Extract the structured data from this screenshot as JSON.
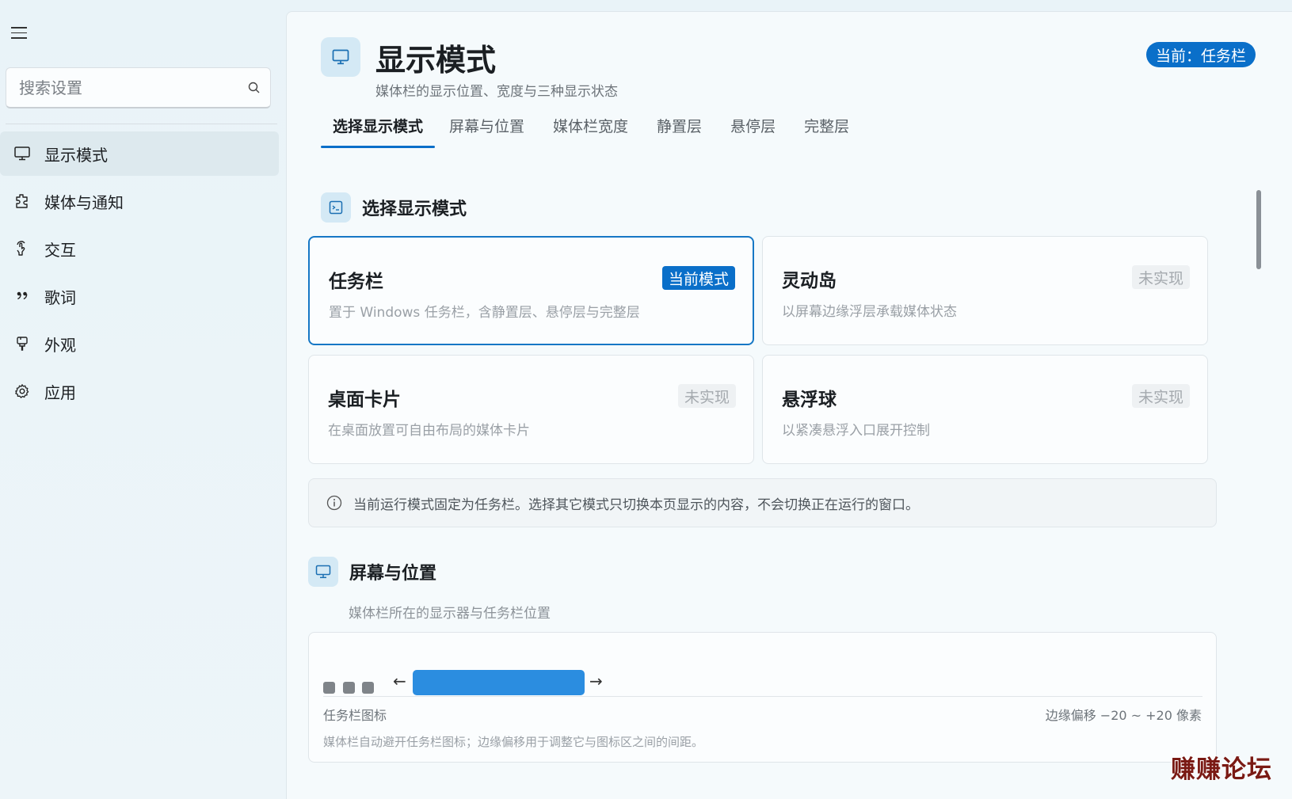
{
  "sidebar": {
    "search_placeholder": "搜索设置",
    "items": [
      {
        "label": "显示模式",
        "icon": "monitor-icon"
      },
      {
        "label": "媒体与通知",
        "icon": "puzzle-icon"
      },
      {
        "label": "交互",
        "icon": "interact-icon"
      },
      {
        "label": "歌词",
        "icon": "quote-icon"
      },
      {
        "label": "外观",
        "icon": "paint-brush-icon"
      },
      {
        "label": "应用",
        "icon": "gear-icon"
      }
    ],
    "active_index": 0
  },
  "header": {
    "title": "显示模式",
    "subtitle": "媒体栏的显示位置、宽度与三种显示状态",
    "current_badge": "当前：任务栏"
  },
  "tabs": [
    "选择显示模式",
    "屏幕与位置",
    "媒体栏宽度",
    "静置层",
    "悬停层",
    "完整层"
  ],
  "section_mode": {
    "title": "选择显示模式",
    "cards": [
      {
        "title": "任务栏",
        "desc": "置于 Windows 任务栏，含静置层、悬停层与完整层",
        "badge": "当前模式"
      },
      {
        "title": "灵动岛",
        "desc": "以屏幕边缘浮层承载媒体状态",
        "badge": "未实现"
      },
      {
        "title": "桌面卡片",
        "desc": "在桌面放置可自由布局的媒体卡片",
        "badge": "未实现"
      },
      {
        "title": "悬浮球",
        "desc": "以紧凑悬浮入口展开控制",
        "badge": "未实现"
      }
    ],
    "info": "当前运行模式固定为任务栏。选择其它模式只切换本页显示的内容，不会切换正在运行的窗口。"
  },
  "section_screen": {
    "title": "屏幕与位置",
    "subtitle": "媒体栏所在的显示器与任务栏位置",
    "preview_label": "任务栏图标",
    "offset_text": "边缘偏移 −20 ~ +20 像素",
    "note": "媒体栏自动避开任务栏图标；边缘偏移用于调整它与图标区之间的间距。",
    "left_arrow": "←",
    "right_arrow": "→"
  },
  "watermark": "赚赚论坛",
  "colors": {
    "accent": "#0a6fc9",
    "bar": "#2b8de0"
  }
}
